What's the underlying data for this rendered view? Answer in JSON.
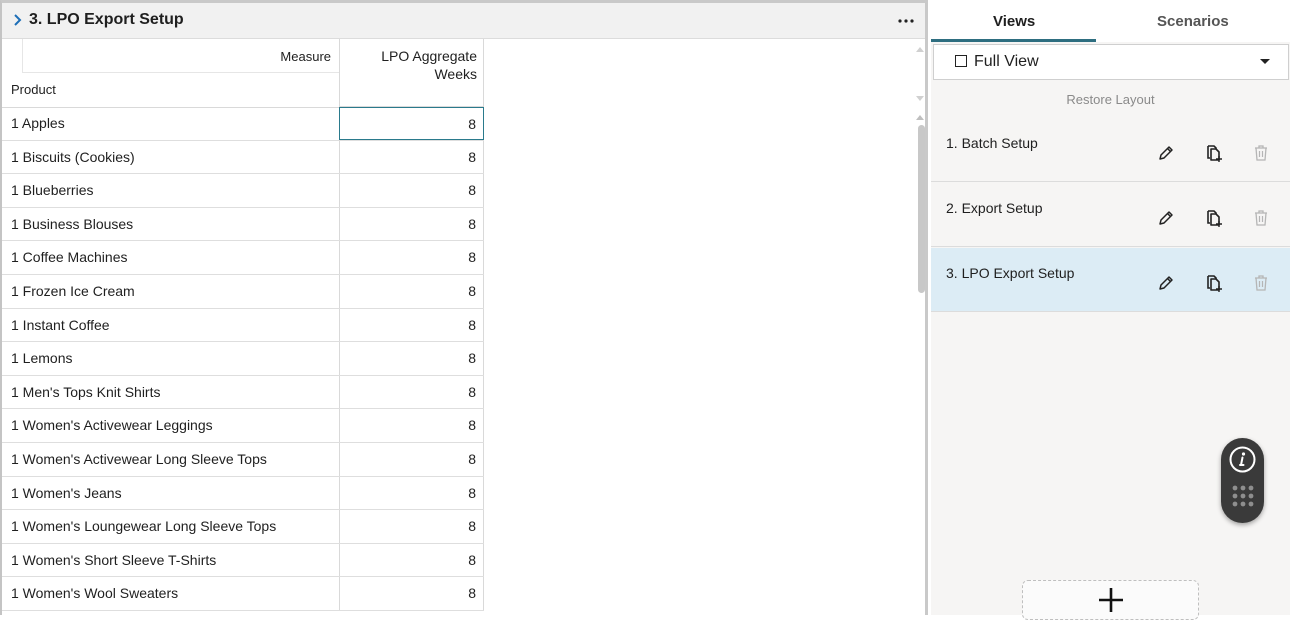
{
  "panel": {
    "title": "3. LPO Export Setup"
  },
  "grid": {
    "measure_label": "Measure",
    "product_label": "Product",
    "column_header": "LPO Aggregate Weeks",
    "rows": [
      {
        "product": "1 Apples",
        "value": "8"
      },
      {
        "product": "1 Biscuits (Cookies)",
        "value": "8"
      },
      {
        "product": "1 Blueberries",
        "value": "8"
      },
      {
        "product": "1 Business Blouses",
        "value": "8"
      },
      {
        "product": "1 Coffee Machines",
        "value": "8"
      },
      {
        "product": "1 Frozen Ice Cream",
        "value": "8"
      },
      {
        "product": "1 Instant Coffee",
        "value": "8"
      },
      {
        "product": "1 Lemons",
        "value": "8"
      },
      {
        "product": "1 Men's Tops Knit Shirts",
        "value": "8"
      },
      {
        "product": "1 Women's Activewear Leggings",
        "value": "8"
      },
      {
        "product": "1 Women's Activewear Long Sleeve Tops",
        "value": "8"
      },
      {
        "product": "1 Women's Jeans",
        "value": "8"
      },
      {
        "product": "1 Women's Loungewear Long Sleeve Tops",
        "value": "8"
      },
      {
        "product": "1 Women's Short Sleeve T-Shirts",
        "value": "8"
      },
      {
        "product": "1 Women's Wool Sweaters",
        "value": "8"
      }
    ]
  },
  "sidebar": {
    "tabs": [
      {
        "label": "Views"
      },
      {
        "label": "Scenarios"
      }
    ],
    "view_select": {
      "label": "Full View"
    },
    "restore_layout": "Restore Layout",
    "views": [
      {
        "label": "1. Batch Setup"
      },
      {
        "label": "2. Export Setup"
      },
      {
        "label": "3. LPO Export Setup"
      }
    ]
  },
  "colors": {
    "accent": "#2e6e80",
    "active_view_bg": "#dcecf5"
  }
}
